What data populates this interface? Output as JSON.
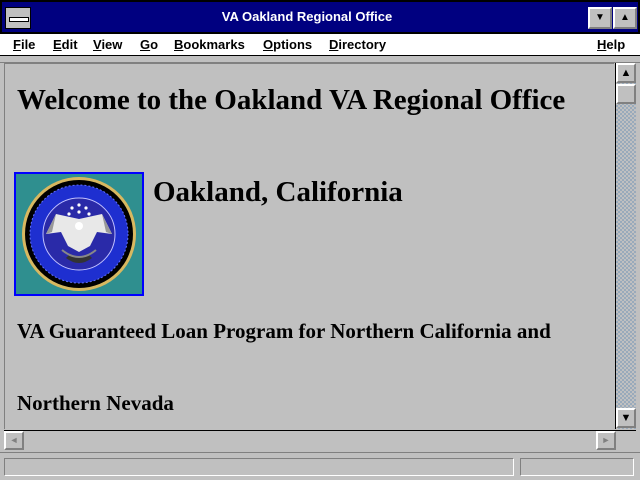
{
  "window": {
    "title": "VA Oakland Regional Office"
  },
  "titlebar": {
    "minimize_icon": "▼",
    "maximize_icon": "▲"
  },
  "menu": {
    "items": [
      "File",
      "Edit",
      "View",
      "Go",
      "Bookmarks",
      "Options",
      "Directory"
    ],
    "help": "Help"
  },
  "page": {
    "heading": "Welcome to the Oakland VA Regional Office",
    "seal_icon": "department-of-veterans-affairs-seal",
    "city": "Oakland, California",
    "para1": "VA Guaranteed Loan Program for Northern California and",
    "para2": "Northern Nevada"
  },
  "scroll": {
    "up": "▲",
    "down": "▼",
    "left": "◄",
    "right": "►"
  },
  "colors": {
    "titlebar": "#000080",
    "seal_bg": "#2f8f8f",
    "seal_border": "#0000ff"
  }
}
